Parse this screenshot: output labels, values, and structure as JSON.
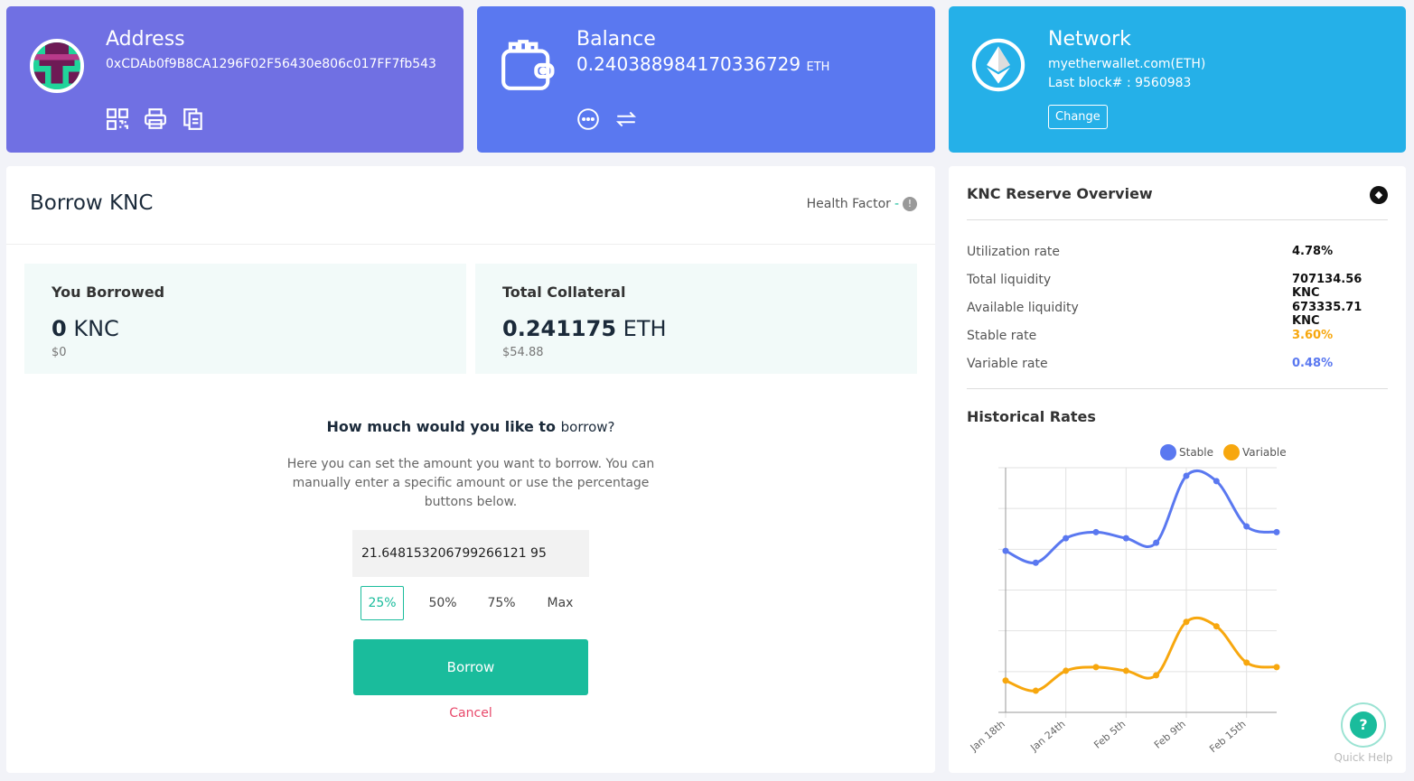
{
  "address": {
    "title": "Address",
    "value": "0xCDAb0f9B8CA1296F02F56430e806c017FF7fb543"
  },
  "balance": {
    "title": "Balance",
    "value": "0.240388984170336729",
    "unit": "ETH"
  },
  "network": {
    "title": "Network",
    "name": "myetherwallet.com(ETH)",
    "last_block": "Last block# : 9560983",
    "change_label": "Change"
  },
  "borrow": {
    "title": "Borrow KNC",
    "health_label": "Health Factor",
    "health_value": "-",
    "borrowed": {
      "label": "You Borrowed",
      "amount": "0",
      "unit": "KNC",
      "usd": "$0"
    },
    "collateral": {
      "label": "Total Collateral",
      "amount": "0.241175",
      "unit": "ETH",
      "usd": "$54.88"
    },
    "question_a": "How much would you like to",
    "question_b": "borrow?",
    "description": "Here you can set the amount you want to borrow. You can manually enter a specific amount or use the percentage buttons below.",
    "amount_value": "21.648153206799266121 95",
    "percent_buttons": [
      "25%",
      "50%",
      "75%",
      "Max"
    ],
    "selected": "25%",
    "borrow_label": "Borrow",
    "cancel_label": "Cancel"
  },
  "reserve": {
    "title": "KNC Reserve Overview",
    "rows": [
      {
        "label": "Utilization rate",
        "value": "4.78%"
      },
      {
        "label": "Total liquidity",
        "value": "707134.56 KNC"
      },
      {
        "label": "Available liquidity",
        "value": "673335.71 KNC"
      },
      {
        "label": "Stable rate",
        "value": "3.60%"
      },
      {
        "label": "Variable rate",
        "value": "0.48%"
      }
    ],
    "history_title": "Historical Rates"
  },
  "quick_help": "Quick Help",
  "colors": {
    "stable": "#5a78f0",
    "variable": "#f7a70e",
    "accent": "#1abc9c",
    "cancel": "#e8496b"
  },
  "chart_data": {
    "type": "line",
    "legend": "top",
    "grid": true,
    "x_tick_labels": [
      "Jan 18th",
      "Jan 24th",
      "Feb 5th",
      "Feb 9th",
      "Feb 15th"
    ],
    "x_tick_indices": [
      0,
      2,
      4,
      6,
      8
    ],
    "series": [
      {
        "name": "Stable",
        "values": [
          3.96,
          3.67,
          4.27,
          4.42,
          4.27,
          4.16,
          5.8,
          5.67,
          4.56,
          4.42
        ]
      },
      {
        "name": "Variable",
        "values": [
          0.78,
          0.53,
          1.02,
          1.11,
          1.02,
          0.91,
          2.22,
          2.11,
          1.22,
          1.11
        ]
      }
    ],
    "ylim": [
      0,
      6
    ]
  }
}
